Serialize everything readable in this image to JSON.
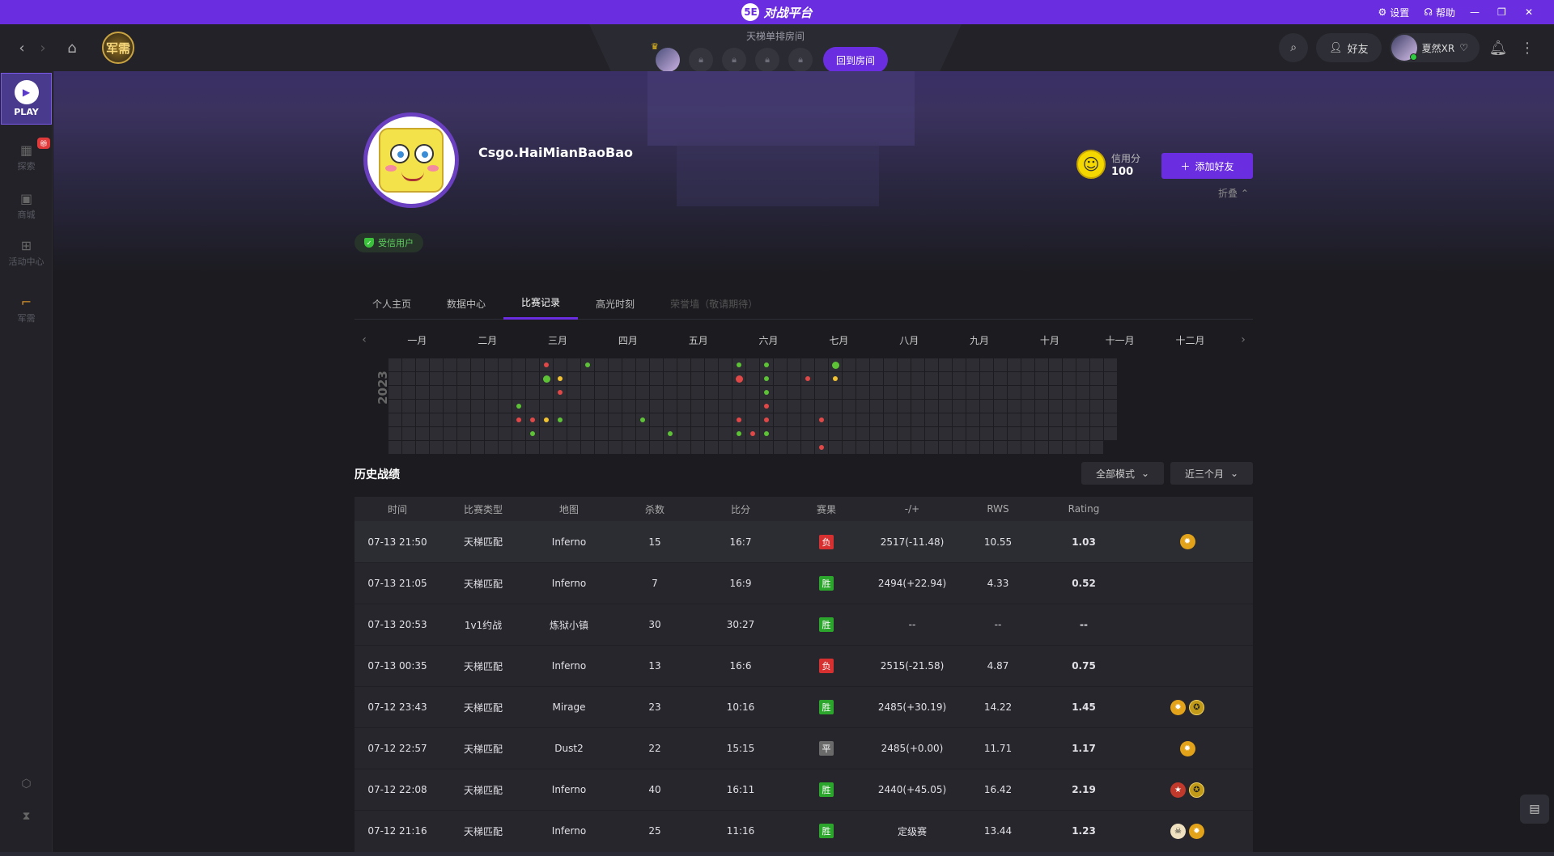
{
  "titlebar": {
    "logo_text": "对战平台",
    "settings_label": "设置",
    "help_label": "帮助",
    "brand_color": "#6a2ee0"
  },
  "navbar": {
    "junxu_label": "军需",
    "room_title": "天梯单排房间",
    "back_room_label": "回到房间",
    "friends_label": "好友",
    "username": "夏然XR"
  },
  "sidebar": {
    "play_label": "PLAY",
    "items": [
      {
        "label": "探索",
        "icon": "grid-icon"
      },
      {
        "label": "商城",
        "icon": "bag-icon"
      },
      {
        "label": "活动中心",
        "icon": "gift-icon"
      },
      {
        "label": "军需",
        "icon": "gun-icon"
      }
    ]
  },
  "profile": {
    "name": "Csgo.HaiMianBaoBao",
    "trust_label": "受信用户",
    "credit_label": "信用分",
    "credit_value": "100",
    "add_friend_label": "添加好友",
    "fold_label": "折叠"
  },
  "tabs": [
    {
      "label": "个人主页",
      "state": "normal"
    },
    {
      "label": "数据中心",
      "state": "normal"
    },
    {
      "label": "比赛记录",
      "state": "active"
    },
    {
      "label": "高光时刻",
      "state": "normal"
    },
    {
      "label": "荣誉墙（敬请期待）",
      "state": "disabled"
    }
  ],
  "calendar": {
    "year": "2023",
    "months": [
      "一月",
      "二月",
      "三月",
      "四月",
      "五月",
      "六月",
      "七月",
      "八月",
      "九月",
      "十月",
      "十一月",
      "十二月"
    ],
    "marks": [
      {
        "col": 9,
        "row": 3,
        "color": "g"
      },
      {
        "col": 9,
        "row": 4,
        "color": "r"
      },
      {
        "col": 10,
        "row": 4,
        "color": "r"
      },
      {
        "col": 10,
        "row": 5,
        "color": "g"
      },
      {
        "col": 11,
        "row": 0,
        "color": "r"
      },
      {
        "col": 11,
        "row": 1,
        "color": "g",
        "big": true
      },
      {
        "col": 11,
        "row": 4,
        "color": "y"
      },
      {
        "col": 12,
        "row": 1,
        "color": "y"
      },
      {
        "col": 12,
        "row": 2,
        "color": "r"
      },
      {
        "col": 12,
        "row": 4,
        "color": "g"
      },
      {
        "col": 14,
        "row": 0,
        "color": "g"
      },
      {
        "col": 18,
        "row": 4,
        "color": "g"
      },
      {
        "col": 20,
        "row": 5,
        "color": "g"
      },
      {
        "col": 25,
        "row": 0,
        "color": "g"
      },
      {
        "col": 25,
        "row": 1,
        "color": "r",
        "big": true
      },
      {
        "col": 25,
        "row": 4,
        "color": "r"
      },
      {
        "col": 25,
        "row": 5,
        "color": "g"
      },
      {
        "col": 26,
        "row": 5,
        "color": "r"
      },
      {
        "col": 27,
        "row": 0,
        "color": "g"
      },
      {
        "col": 27,
        "row": 1,
        "color": "g"
      },
      {
        "col": 27,
        "row": 2,
        "color": "g"
      },
      {
        "col": 27,
        "row": 3,
        "color": "r"
      },
      {
        "col": 27,
        "row": 4,
        "color": "r"
      },
      {
        "col": 27,
        "row": 5,
        "color": "g"
      },
      {
        "col": 30,
        "row": 1,
        "color": "r"
      },
      {
        "col": 31,
        "row": 4,
        "color": "r"
      },
      {
        "col": 31,
        "row": 6,
        "color": "r"
      },
      {
        "col": 32,
        "row": 0,
        "color": "g",
        "big": true
      },
      {
        "col": 32,
        "row": 1,
        "color": "y"
      }
    ]
  },
  "history": {
    "title": "历史战绩",
    "mode_filter": "全部模式",
    "range_filter": "近三个月",
    "columns": [
      "时间",
      "比赛类型",
      "地图",
      "杀数",
      "比分",
      "赛果",
      "-/+",
      "RWS",
      "Rating"
    ],
    "rows": [
      {
        "time": "07-13 21:50",
        "type": "天梯匹配",
        "map": "Inferno",
        "kills": "15",
        "score": "16:7",
        "result": "负",
        "res": "lose",
        "elo": "2517(-11.48)",
        "rws": "10.55",
        "rating": "1.03",
        "badges": [
          "bomb"
        ]
      },
      {
        "time": "07-13 21:05",
        "type": "天梯匹配",
        "map": "Inferno",
        "kills": "7",
        "score": "16:9",
        "result": "胜",
        "res": "win",
        "elo": "2494(+22.94)",
        "rws": "4.33",
        "rating": "0.52",
        "badges": []
      },
      {
        "time": "07-13 20:53",
        "type": "1v1约战",
        "map": "炼狱小镇",
        "kills": "30",
        "score": "30:27",
        "result": "胜",
        "res": "win",
        "elo": "--",
        "rws": "--",
        "rating": "--",
        "badges": []
      },
      {
        "time": "07-13 00:35",
        "type": "天梯匹配",
        "map": "Inferno",
        "kills": "13",
        "score": "16:6",
        "result": "负",
        "res": "lose",
        "elo": "2515(-21.58)",
        "rws": "4.87",
        "rating": "0.75",
        "badges": []
      },
      {
        "time": "07-12 23:43",
        "type": "天梯匹配",
        "map": "Mirage",
        "kills": "23",
        "score": "10:16",
        "result": "胜",
        "res": "win",
        "elo": "2485(+30.19)",
        "rws": "14.22",
        "rating": "1.45",
        "badges": [
          "bomb",
          "medal"
        ]
      },
      {
        "time": "07-12 22:57",
        "type": "天梯匹配",
        "map": "Dust2",
        "kills": "22",
        "score": "15:15",
        "result": "平",
        "res": "draw",
        "elo": "2485(+0.00)",
        "rws": "11.71",
        "rating": "1.17",
        "badges": [
          "bomb"
        ]
      },
      {
        "time": "07-12 22:08",
        "type": "天梯匹配",
        "map": "Inferno",
        "kills": "40",
        "score": "16:11",
        "result": "胜",
        "res": "win",
        "elo": "2440(+45.05)",
        "rws": "16.42",
        "rating": "2.19",
        "badges": [
          "star",
          "medal"
        ]
      },
      {
        "time": "07-12 21:16",
        "type": "天梯匹配",
        "map": "Inferno",
        "kills": "25",
        "score": "11:16",
        "result": "胜",
        "res": "win",
        "elo": "定级赛",
        "rws": "13.44",
        "rating": "1.23",
        "badges": [
          "skull",
          "bomb"
        ]
      }
    ]
  }
}
